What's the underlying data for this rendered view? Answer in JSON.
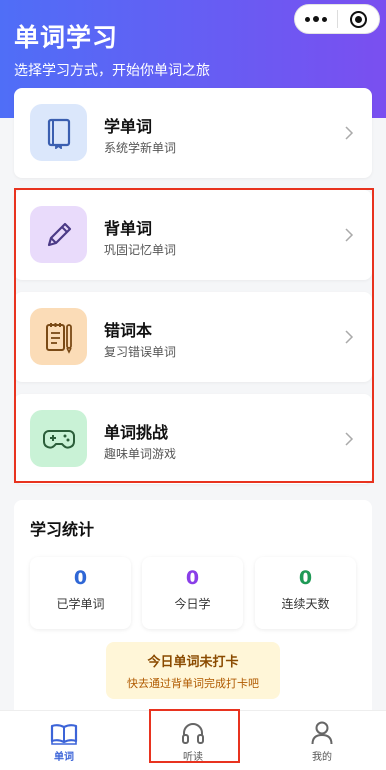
{
  "header": {
    "title": "单词学习",
    "subtitle": "选择学习方式，开始你单词之旅"
  },
  "capsule": {
    "more_icon": "more-dots-icon",
    "close_icon": "target-close-icon"
  },
  "cards": [
    {
      "title": "学单词",
      "desc": "系统学新单词",
      "icon": "book-icon",
      "icon_bg": "#dbe7fb",
      "icon_color": "#3b5fb0"
    },
    {
      "title": "背单词",
      "desc": "巩固记忆单词",
      "icon": "pencil-icon",
      "icon_bg": "#e9dbfb",
      "icon_color": "#4b3a86"
    },
    {
      "title": "错词本",
      "desc": "复习错误单词",
      "icon": "notepad-icon",
      "icon_bg": "#fbdcb7",
      "icon_color": "#7a4a16"
    },
    {
      "title": "单词挑战",
      "desc": "趣味单词游戏",
      "icon": "gamepad-icon",
      "icon_bg": "#c9f2d6",
      "icon_color": "#2b5e3a"
    }
  ],
  "stats": {
    "title": "学习统计",
    "items": [
      {
        "value": "0",
        "label": "已学单词",
        "color": "#2f67d6"
      },
      {
        "value": "0",
        "label": "今日学",
        "color": "#8a3ee8"
      },
      {
        "value": "0",
        "label": "连续天数",
        "color": "#1f9a56"
      }
    ],
    "checkin": {
      "title": "今日单词未打卡",
      "subtitle": "快去通过背单词完成打卡吧"
    }
  },
  "tabbar": {
    "items": [
      {
        "label": "单词",
        "icon": "open-book-icon",
        "active": true
      },
      {
        "label": "听读",
        "icon": "headphones-icon",
        "active": false
      },
      {
        "label": "我的",
        "icon": "user-icon",
        "active": false
      }
    ]
  },
  "colors": {
    "accent": "#3c64d8",
    "highlight": "#e8331f",
    "header_start": "#4f6ef7",
    "header_end": "#7a4ff0"
  }
}
